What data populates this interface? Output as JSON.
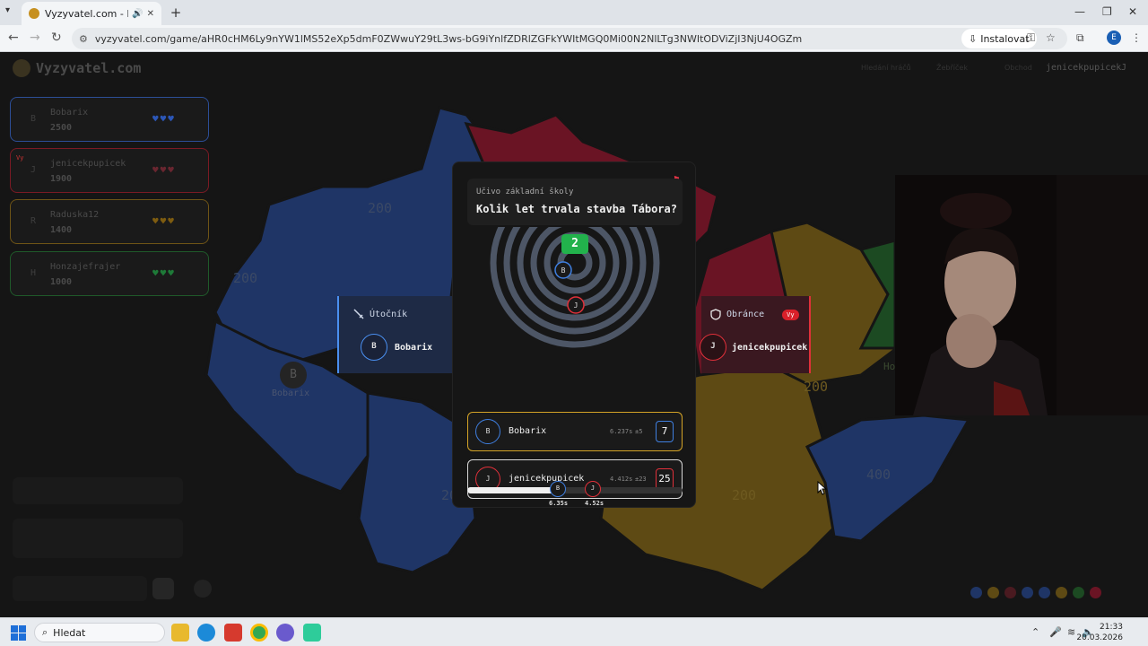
{
  "browser": {
    "tab_title": "Vyzyvatel.com - Komunitní",
    "url": "vyzyvatel.com/game/aHR0cHM6Ly9nYW1lMS52eXp5dmF0ZWwuY29tL3ws-bG9iYnlfZDRlZGFkYWItMGQ0Mi00N2NlLTg3NWItODViZjI3NjU4OGZm",
    "install_label": "Instalovat",
    "profile_initial": "E"
  },
  "site": {
    "logo_text": "Vyzyvatel.com",
    "nav_links": [
      "Hledání hráčů",
      "Žebříček",
      "Obchod"
    ],
    "username": "jenicekpupicek",
    "user_initial": "J"
  },
  "players": [
    {
      "initial": "B",
      "name": "Bobarix",
      "score": "2500",
      "border": "#2c4e96",
      "hearts": "♥♥♥",
      "heart_color": "#2c57b8",
      "badge": ""
    },
    {
      "initial": "J",
      "name": "jenicekpupicek",
      "score": "1900",
      "border": "#7a1a24",
      "hearts": "♥♥♥",
      "heart_color": "#6a2630",
      "badge": "Vy"
    },
    {
      "initial": "R",
      "name": "Raduska12",
      "score": "1400",
      "border": "#6e5416",
      "hearts": "♥♥♥",
      "heart_color": "#7e5c10",
      "badge": ""
    },
    {
      "initial": "H",
      "name": "Honzajefrajer",
      "score": "1000",
      "border": "#1f5a2a",
      "hearts": "♥♥♥",
      "heart_color": "#1e7a38",
      "badge": ""
    }
  ],
  "map": {
    "region_values": [
      "200",
      "200",
      "200",
      "200",
      "200",
      "200",
      "400"
    ],
    "marker_initial": "B",
    "marker_name": "Bobarix",
    "partial_label": "Ho"
  },
  "attacker": {
    "title": "Útočník",
    "initial": "B",
    "name": "Bobarix"
  },
  "defender": {
    "title": "Obránce",
    "badge": "Vy",
    "initial": "J",
    "name": "jenicekpupicek"
  },
  "question": {
    "category": "Učivo základní školy",
    "text": "Kolik let trvala stavba Tábora?",
    "correct_answer": "2",
    "answers": [
      {
        "initial": "B",
        "name": "Bobarix",
        "time": "6.237s",
        "diff": "±5",
        "value": "7",
        "color": "#3f7fe0",
        "border": "#d4a326"
      },
      {
        "initial": "J",
        "name": "jenicekpupicek",
        "time": "4.412s",
        "diff": "±23",
        "value": "25",
        "color": "#e0303a",
        "border": "#d8d8d8"
      }
    ],
    "timeline": {
      "progress": 0.42,
      "markers": [
        {
          "initial": "B",
          "label": "6.35s",
          "color": "#3f7fe0"
        },
        {
          "initial": "J",
          "label": "4.52s",
          "color": "#e0303a"
        }
      ]
    }
  },
  "taskbar": {
    "search_label": "Hledat",
    "time": "21:33",
    "date": "20.03.2026"
  },
  "icons": {
    "attacker": "sword-icon",
    "defender": "shield-icon",
    "report": "flag-icon"
  },
  "colors": {
    "blue_team": "#1f3566",
    "red_team": "#6a1424",
    "gold_team": "#5e4a14",
    "green_team": "#1c4a22",
    "correct": "#22b24c"
  }
}
